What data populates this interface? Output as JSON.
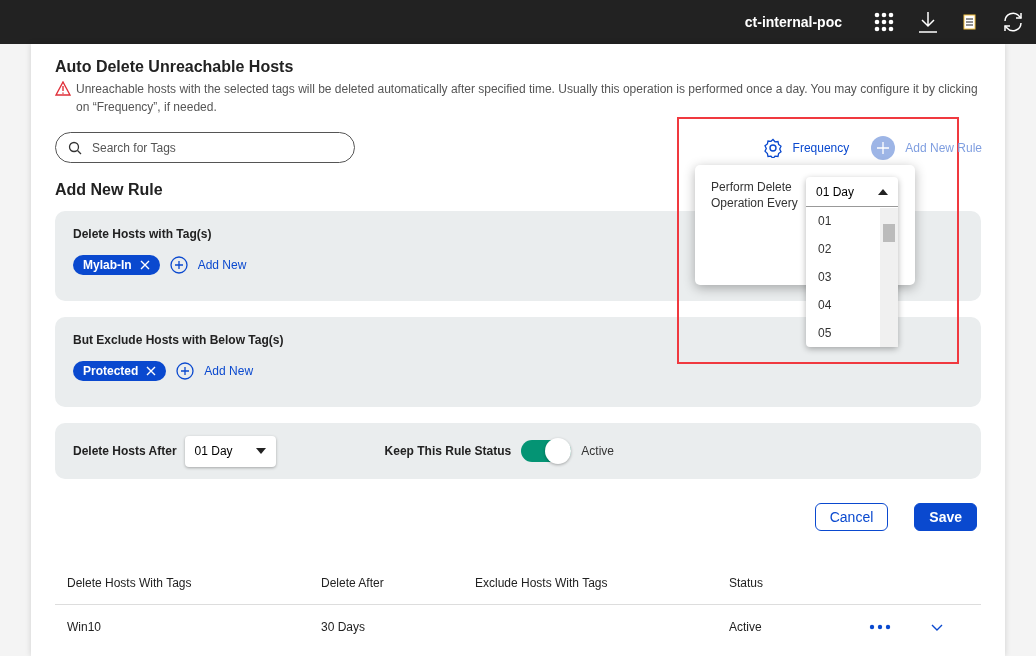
{
  "top_bar": {
    "workspace": "ct-internal-poc"
  },
  "page": {
    "title": "Auto Delete Unreachable Hosts",
    "warning": "Unreachable hosts with the selected tags will be deleted automatically after specified time. Usually this operation is performed once a day. You may configure it by clicking on “Frequency”, if needed."
  },
  "search": {
    "placeholder": "Search for Tags"
  },
  "frequency_link": "Frequency",
  "add_new_rule": {
    "label": "Add New Rule",
    "disabled": true
  },
  "frequency_popover": {
    "label": "Perform Delete Operation Every",
    "value": "01 Day",
    "expanded": true,
    "options": [
      "01",
      "02",
      "03",
      "04",
      "05"
    ]
  },
  "section_title": "Add New Rule",
  "include_tags": {
    "title": "Delete Hosts with Tag(s)",
    "tags": [
      "Mylab-In"
    ],
    "add_label": "Add New"
  },
  "exclude_tags": {
    "title": "But Exclude Hosts with Below Tag(s)",
    "tags": [
      "Protected"
    ],
    "add_label": "Add New"
  },
  "delete_after": {
    "label": "Delete Hosts After",
    "value": "01 Day"
  },
  "rule_status": {
    "label": "Keep This Rule Status",
    "on": true,
    "state_label": "Active"
  },
  "buttons": {
    "cancel": "Cancel",
    "save": "Save"
  },
  "table": {
    "columns": [
      "Delete Hosts With Tags",
      "Delete After",
      "Exclude Hosts With Tags",
      "Status"
    ],
    "rows": [
      {
        "cells": [
          "Win10",
          "30 Days",
          "",
          "Active"
        ]
      }
    ]
  }
}
